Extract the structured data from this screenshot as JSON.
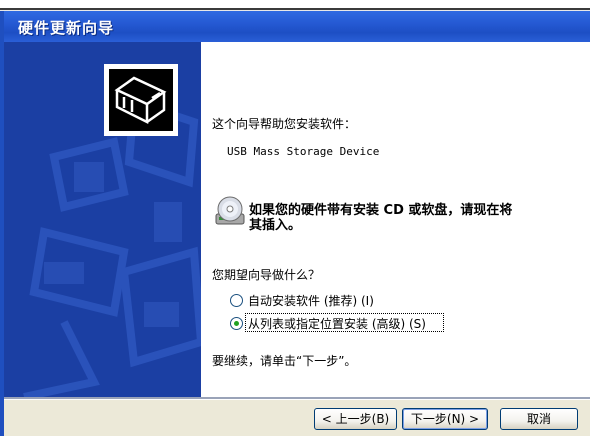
{
  "window": {
    "title": "硬件更新向导"
  },
  "content": {
    "intro": "这个向导帮助您安装软件：",
    "device_name": "USB Mass Storage Device",
    "cd_prompt_line1": "如果您的硬件带有安装 CD 或软盘，请现在将",
    "cd_prompt_line2": "其插入。",
    "question": "您期望向导做什么？",
    "options": [
      {
        "label": "自动安装软件 (推荐) (I)",
        "selected": false
      },
      {
        "label": "从列表或指定位置安装 (高级) (S)",
        "selected": true
      }
    ],
    "continue_hint": "要继续，请单击“下一步”。"
  },
  "buttons": {
    "back": "< 上一步(B)",
    "next": "下一步(N) >",
    "cancel": "取消"
  },
  "icons": [
    "hardware-wizard-icon",
    "cd-disk-icon"
  ],
  "colors": {
    "title_bar": "#2559d3",
    "left_panel": "#1b3fa3",
    "radio_selected": "#21a121"
  }
}
